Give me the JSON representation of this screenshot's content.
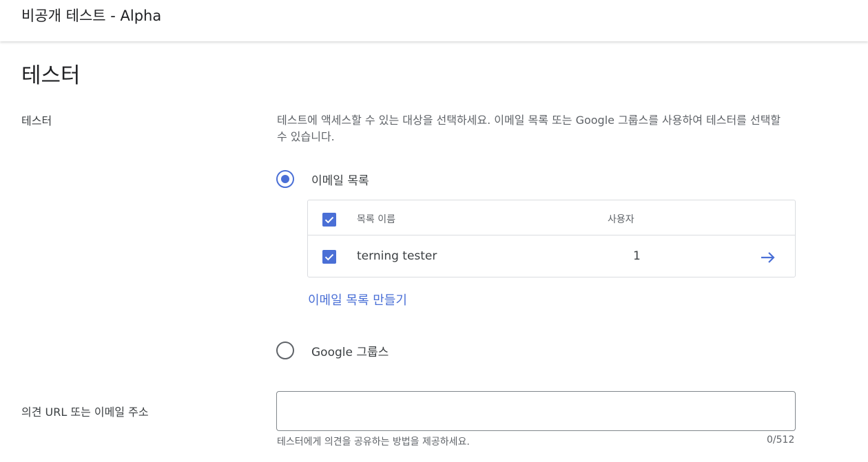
{
  "header": {
    "title": "비공개 테스트 - Alpha"
  },
  "section": {
    "title": "테스터"
  },
  "testers": {
    "label": "테스터",
    "description": "테스트에 액세스할 수 있는 대상을 선택하세요. 이메일 목록 또는 Google 그룹스를 사용하여 테스터를 선택할 수 있습니다.",
    "options": {
      "email_list": {
        "label": "이메일 목록",
        "selected": true
      },
      "google_groups": {
        "label": "Google 그룹스",
        "selected": false
      }
    },
    "table": {
      "col_name": "목록 이름",
      "col_users": "사용자",
      "rows": [
        {
          "name": "terning tester",
          "users": "1",
          "checked": true
        }
      ]
    },
    "create_link": "이메일 목록 만들기"
  },
  "feedback": {
    "label": "의견 URL 또는 이메일 주소",
    "value": "",
    "helper": "테스터에게 의견을 공유하는 방법을 제공하세요.",
    "counter": "0/512"
  },
  "colors": {
    "accent": "#4a6fd6",
    "text_primary": "#202124",
    "text_secondary": "#5f6368",
    "border": "#dadce0"
  },
  "icons": {
    "checkbox": "check-icon",
    "row_action": "arrow-right-icon"
  }
}
